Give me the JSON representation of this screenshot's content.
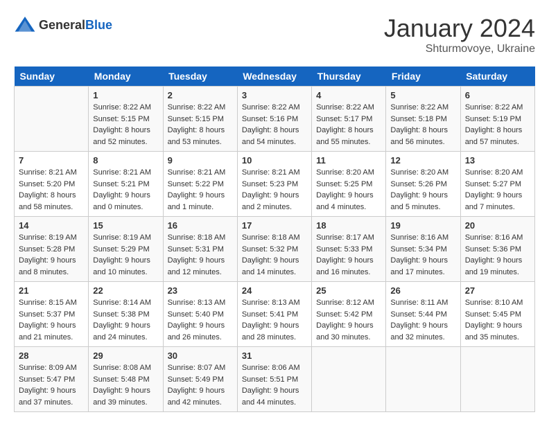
{
  "header": {
    "logo_general": "General",
    "logo_blue": "Blue",
    "month_year": "January 2024",
    "location": "Shturmovoye, Ukraine"
  },
  "days_of_week": [
    "Sunday",
    "Monday",
    "Tuesday",
    "Wednesday",
    "Thursday",
    "Friday",
    "Saturday"
  ],
  "weeks": [
    [
      {
        "day": "",
        "sunrise": "",
        "sunset": "",
        "daylight": ""
      },
      {
        "day": "1",
        "sunrise": "Sunrise: 8:22 AM",
        "sunset": "Sunset: 5:15 PM",
        "daylight": "Daylight: 8 hours and 52 minutes."
      },
      {
        "day": "2",
        "sunrise": "Sunrise: 8:22 AM",
        "sunset": "Sunset: 5:15 PM",
        "daylight": "Daylight: 8 hours and 53 minutes."
      },
      {
        "day": "3",
        "sunrise": "Sunrise: 8:22 AM",
        "sunset": "Sunset: 5:16 PM",
        "daylight": "Daylight: 8 hours and 54 minutes."
      },
      {
        "day": "4",
        "sunrise": "Sunrise: 8:22 AM",
        "sunset": "Sunset: 5:17 PM",
        "daylight": "Daylight: 8 hours and 55 minutes."
      },
      {
        "day": "5",
        "sunrise": "Sunrise: 8:22 AM",
        "sunset": "Sunset: 5:18 PM",
        "daylight": "Daylight: 8 hours and 56 minutes."
      },
      {
        "day": "6",
        "sunrise": "Sunrise: 8:22 AM",
        "sunset": "Sunset: 5:19 PM",
        "daylight": "Daylight: 8 hours and 57 minutes."
      }
    ],
    [
      {
        "day": "7",
        "sunrise": "Sunrise: 8:21 AM",
        "sunset": "Sunset: 5:20 PM",
        "daylight": "Daylight: 8 hours and 58 minutes."
      },
      {
        "day": "8",
        "sunrise": "Sunrise: 8:21 AM",
        "sunset": "Sunset: 5:21 PM",
        "daylight": "Daylight: 9 hours and 0 minutes."
      },
      {
        "day": "9",
        "sunrise": "Sunrise: 8:21 AM",
        "sunset": "Sunset: 5:22 PM",
        "daylight": "Daylight: 9 hours and 1 minute."
      },
      {
        "day": "10",
        "sunrise": "Sunrise: 8:21 AM",
        "sunset": "Sunset: 5:23 PM",
        "daylight": "Daylight: 9 hours and 2 minutes."
      },
      {
        "day": "11",
        "sunrise": "Sunrise: 8:20 AM",
        "sunset": "Sunset: 5:25 PM",
        "daylight": "Daylight: 9 hours and 4 minutes."
      },
      {
        "day": "12",
        "sunrise": "Sunrise: 8:20 AM",
        "sunset": "Sunset: 5:26 PM",
        "daylight": "Daylight: 9 hours and 5 minutes."
      },
      {
        "day": "13",
        "sunrise": "Sunrise: 8:20 AM",
        "sunset": "Sunset: 5:27 PM",
        "daylight": "Daylight: 9 hours and 7 minutes."
      }
    ],
    [
      {
        "day": "14",
        "sunrise": "Sunrise: 8:19 AM",
        "sunset": "Sunset: 5:28 PM",
        "daylight": "Daylight: 9 hours and 8 minutes."
      },
      {
        "day": "15",
        "sunrise": "Sunrise: 8:19 AM",
        "sunset": "Sunset: 5:29 PM",
        "daylight": "Daylight: 9 hours and 10 minutes."
      },
      {
        "day": "16",
        "sunrise": "Sunrise: 8:18 AM",
        "sunset": "Sunset: 5:31 PM",
        "daylight": "Daylight: 9 hours and 12 minutes."
      },
      {
        "day": "17",
        "sunrise": "Sunrise: 8:18 AM",
        "sunset": "Sunset: 5:32 PM",
        "daylight": "Daylight: 9 hours and 14 minutes."
      },
      {
        "day": "18",
        "sunrise": "Sunrise: 8:17 AM",
        "sunset": "Sunset: 5:33 PM",
        "daylight": "Daylight: 9 hours and 16 minutes."
      },
      {
        "day": "19",
        "sunrise": "Sunrise: 8:16 AM",
        "sunset": "Sunset: 5:34 PM",
        "daylight": "Daylight: 9 hours and 17 minutes."
      },
      {
        "day": "20",
        "sunrise": "Sunrise: 8:16 AM",
        "sunset": "Sunset: 5:36 PM",
        "daylight": "Daylight: 9 hours and 19 minutes."
      }
    ],
    [
      {
        "day": "21",
        "sunrise": "Sunrise: 8:15 AM",
        "sunset": "Sunset: 5:37 PM",
        "daylight": "Daylight: 9 hours and 21 minutes."
      },
      {
        "day": "22",
        "sunrise": "Sunrise: 8:14 AM",
        "sunset": "Sunset: 5:38 PM",
        "daylight": "Daylight: 9 hours and 24 minutes."
      },
      {
        "day": "23",
        "sunrise": "Sunrise: 8:13 AM",
        "sunset": "Sunset: 5:40 PM",
        "daylight": "Daylight: 9 hours and 26 minutes."
      },
      {
        "day": "24",
        "sunrise": "Sunrise: 8:13 AM",
        "sunset": "Sunset: 5:41 PM",
        "daylight": "Daylight: 9 hours and 28 minutes."
      },
      {
        "day": "25",
        "sunrise": "Sunrise: 8:12 AM",
        "sunset": "Sunset: 5:42 PM",
        "daylight": "Daylight: 9 hours and 30 minutes."
      },
      {
        "day": "26",
        "sunrise": "Sunrise: 8:11 AM",
        "sunset": "Sunset: 5:44 PM",
        "daylight": "Daylight: 9 hours and 32 minutes."
      },
      {
        "day": "27",
        "sunrise": "Sunrise: 8:10 AM",
        "sunset": "Sunset: 5:45 PM",
        "daylight": "Daylight: 9 hours and 35 minutes."
      }
    ],
    [
      {
        "day": "28",
        "sunrise": "Sunrise: 8:09 AM",
        "sunset": "Sunset: 5:47 PM",
        "daylight": "Daylight: 9 hours and 37 minutes."
      },
      {
        "day": "29",
        "sunrise": "Sunrise: 8:08 AM",
        "sunset": "Sunset: 5:48 PM",
        "daylight": "Daylight: 9 hours and 39 minutes."
      },
      {
        "day": "30",
        "sunrise": "Sunrise: 8:07 AM",
        "sunset": "Sunset: 5:49 PM",
        "daylight": "Daylight: 9 hours and 42 minutes."
      },
      {
        "day": "31",
        "sunrise": "Sunrise: 8:06 AM",
        "sunset": "Sunset: 5:51 PM",
        "daylight": "Daylight: 9 hours and 44 minutes."
      },
      {
        "day": "",
        "sunrise": "",
        "sunset": "",
        "daylight": ""
      },
      {
        "day": "",
        "sunrise": "",
        "sunset": "",
        "daylight": ""
      },
      {
        "day": "",
        "sunrise": "",
        "sunset": "",
        "daylight": ""
      }
    ]
  ]
}
